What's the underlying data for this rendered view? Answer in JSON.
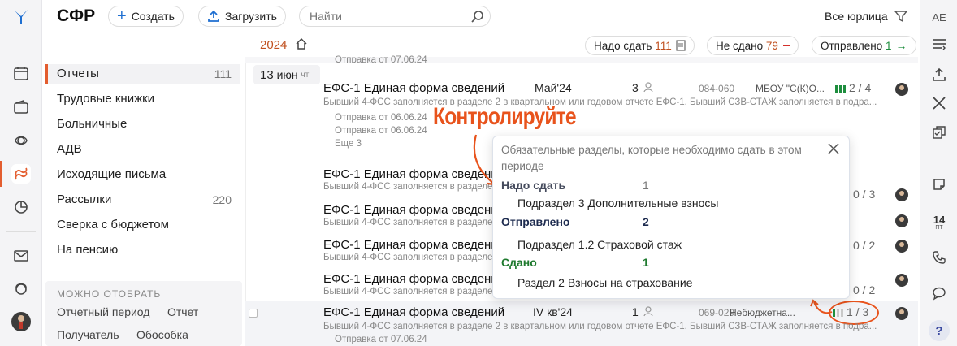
{
  "app": {
    "title": "СФР"
  },
  "toolbar": {
    "create_label": "Создать",
    "upload_label": "Загрузить",
    "search_placeholder": "Найти",
    "org_filter_label": "Все юрлица",
    "user_initials": "АЕ"
  },
  "period": {
    "year": "2024"
  },
  "summary": {
    "to_submit_label": "Надо сдать",
    "to_submit_count": "111",
    "not_submitted_label": "Не сдано",
    "not_submitted_count": "79",
    "sent_label": "Отправлено",
    "sent_count": "1"
  },
  "sidebar": {
    "items": [
      {
        "label": "Отчеты",
        "count": "111"
      },
      {
        "label": "Трудовые книжки",
        "count": ""
      },
      {
        "label": "Больничные",
        "count": ""
      },
      {
        "label": "АДВ",
        "count": ""
      },
      {
        "label": "Исходящие письма",
        "count": ""
      },
      {
        "label": "Рассылки",
        "count": "220"
      },
      {
        "label": "Сверка с бюджетом",
        "count": ""
      },
      {
        "label": "На пенсию",
        "count": ""
      }
    ],
    "filter_heading": "МОЖНО ОТОБРАТЬ",
    "filters": [
      "Отчетный период",
      "Отчет",
      "Получатель",
      "Обособка"
    ]
  },
  "list": {
    "cut_top_text": "Отправка от 07.06.24",
    "date": {
      "day": "13",
      "month": "июн",
      "weekday": "чт"
    },
    "row1": {
      "title": "ЕФС-1 Единая форма сведений",
      "period": "Май'24",
      "count": "3",
      "reg": "084-060",
      "org": "МБОУ \"С(К)О...",
      "progress": "2 / 4",
      "desc": "Бывший 4-ФСС заполняется в разделе 2 в квартальном или годовом отчете ЕФС-1. Бывший СЗВ-СТАЖ заполняется в подра...",
      "sub1": "Отправка от 06.06.24",
      "sub2": "Отправка от 06.06.24",
      "sub3": "Еще 3"
    },
    "rows": [
      {
        "title": "ЕФС-1 Единая форма сведений",
        "desc": "Бывший 4-ФСС заполняется в разделе",
        "progress": "0 / 3"
      },
      {
        "title": "ЕФС-1 Единая форма сведений",
        "desc": "Бывший 4-ФСС заполняется в разделе",
        "progress": ""
      },
      {
        "title": "ЕФС-1 Единая форма сведений",
        "desc": "Бывший 4-ФСС заполняется в разделе",
        "progress": "0 / 2"
      },
      {
        "title": "ЕФС-1 Единая форма сведений",
        "desc": "Бывший 4-ФСС заполняется в разделе",
        "progress": "0 / 2"
      }
    ],
    "row_last": {
      "title": "ЕФС-1 Единая форма сведений",
      "period": "IV кв'24",
      "count": "1",
      "reg": "069-029",
      "org": "Небюджетна...",
      "progress": "1 / 3",
      "desc": "Бывший 4-ФСС заполняется в разделе 2 в квартальном или годовом отчете ЕФС-1. Бывший СЗВ-СТАЖ заполняется в подра...",
      "sub1": "Отправка от 07.06.24"
    }
  },
  "popup": {
    "heading": "Обязательные разделы, которые необходимо сдать в этом периоде",
    "groups": [
      {
        "label": "Надо сдать",
        "count": "1",
        "item": "Подраздел 3 Дополнительные взносы",
        "color": "#444a5c"
      },
      {
        "label": "Отправлено",
        "count": "2",
        "item": "Подраздел 1.2 Страховой стаж",
        "color": "#1d2b4f"
      },
      {
        "label": "Сдано",
        "count": "1",
        "item": "Раздел 2 Взносы на страхование",
        "color": "#1e7a2e"
      }
    ]
  },
  "annotation": {
    "text": "Контролируйте",
    "color": "#e8531c"
  },
  "right_rail": {
    "calendar_day": "14",
    "calendar_weekday": "ПТ",
    "help_label": "?"
  },
  "colors": {
    "accent": "#e35d2f",
    "brand_blue": "#1f6fd1",
    "ok_green": "#1e8e3e",
    "danger_red": "#d4302b"
  }
}
